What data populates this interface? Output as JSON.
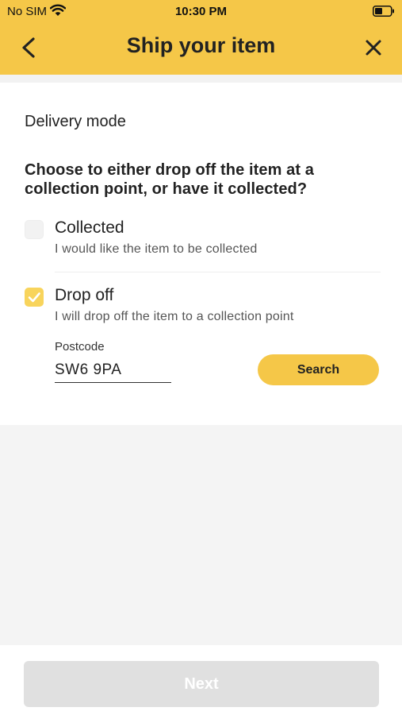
{
  "status_bar": {
    "carrier": "No SIM",
    "time": "10:30 PM"
  },
  "header": {
    "title": "Ship your item",
    "back_icon": "chevron-left-icon",
    "close_icon": "close-icon",
    "background_color": "#f5c748"
  },
  "content": {
    "section_label": "Delivery mode",
    "question": "Choose to either drop off the item at a collection point, or have it collected?",
    "options": [
      {
        "title": "Collected",
        "description": "I would like the item to be collected",
        "checked": false
      },
      {
        "title": "Drop off",
        "description": "I will drop off the item to a collection point",
        "checked": true
      }
    ],
    "postcode": {
      "label": "Postcode",
      "value": "SW6 9PA"
    },
    "search_label": "Search"
  },
  "footer": {
    "next_label": "Next",
    "next_enabled": false
  }
}
